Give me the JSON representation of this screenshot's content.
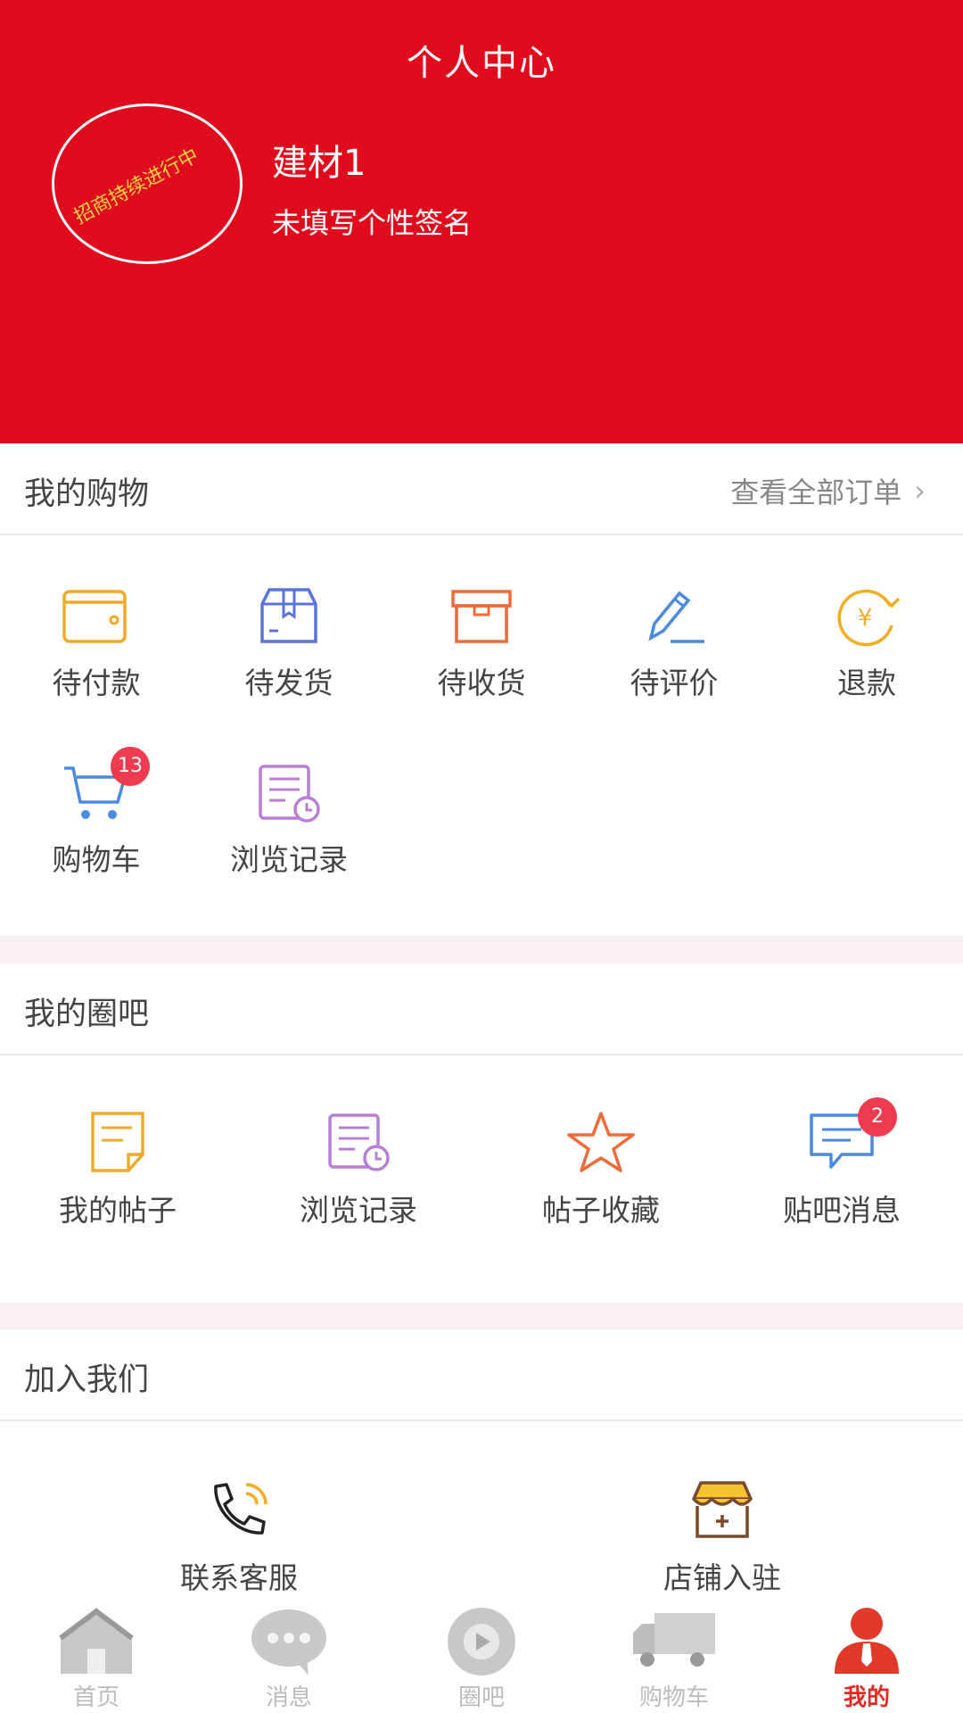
{
  "header": {
    "title": "个人中心",
    "avatar_text": "招商持续进行中",
    "username": "建材1",
    "signature": "未填写个性签名"
  },
  "shopping": {
    "title": "我的购物",
    "view_all": "查看全部订单",
    "items": [
      {
        "label": "待付款",
        "icon": "wallet-icon"
      },
      {
        "label": "待发货",
        "icon": "package-icon"
      },
      {
        "label": "待收货",
        "icon": "box-icon"
      },
      {
        "label": "待评价",
        "icon": "pen-icon"
      },
      {
        "label": "退款",
        "icon": "refund-yen-icon"
      },
      {
        "label": "购物车",
        "icon": "cart-icon",
        "badge": "13"
      },
      {
        "label": "浏览记录",
        "icon": "history-icon"
      }
    ]
  },
  "circle": {
    "title": "我的圈吧",
    "items": [
      {
        "label": "我的帖子",
        "icon": "note-icon"
      },
      {
        "label": "浏览记录",
        "icon": "history-icon"
      },
      {
        "label": "帖子收藏",
        "icon": "star-icon"
      },
      {
        "label": "贴吧消息",
        "icon": "message-icon",
        "badge": "2"
      }
    ]
  },
  "join": {
    "title": "加入我们",
    "items": [
      {
        "label": "联系客服",
        "icon": "phone-icon"
      },
      {
        "label": "店铺入驻",
        "icon": "shop-icon"
      }
    ]
  },
  "tabbar": {
    "items": [
      {
        "label": "首页",
        "icon": "home-icon"
      },
      {
        "label": "消息",
        "icon": "chat-icon"
      },
      {
        "label": "圈吧",
        "icon": "circle-icon"
      },
      {
        "label": "购物车",
        "icon": "truck-icon"
      },
      {
        "label": "我的",
        "icon": "user-icon",
        "active": true
      }
    ]
  },
  "colors": {
    "brand": "#e00b1c",
    "badge": "#ef3b4f",
    "active_tab": "#e02a23"
  }
}
